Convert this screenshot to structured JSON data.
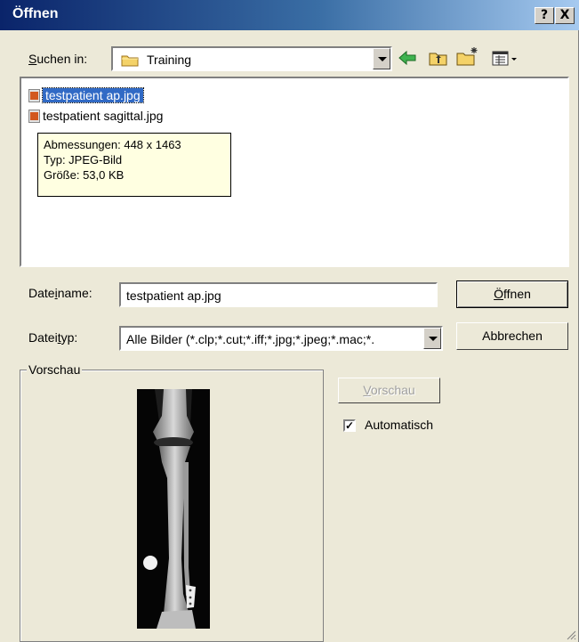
{
  "window": {
    "title": "Öffnen",
    "help_button": "?",
    "close_button": "X"
  },
  "look_in": {
    "label_u": "S",
    "label_rest": "uchen in:",
    "value": "Training"
  },
  "files": [
    {
      "name": "testpatient ap.jpg",
      "selected": true
    },
    {
      "name": "testpatient sagittal.jpg",
      "selected": false
    }
  ],
  "tooltip": {
    "line1": "Abmessungen: 448 x 1463",
    "line2": "Typ: JPEG-Bild",
    "line3": "Größe: 53,0 KB"
  },
  "filename": {
    "label_a": "Date",
    "label_u": "i",
    "label_b": "name:",
    "value": "testpatient ap.jpg"
  },
  "filetype": {
    "label_a": "Datei",
    "label_u": "t",
    "label_b": "yp:",
    "value": "Alle Bilder (*.clp;*.cut;*.iff;*.jpg;*.jpeg;*.mac;*."
  },
  "buttons": {
    "open_u": "Ö",
    "open_rest": "ffnen",
    "cancel": "Abbrechen",
    "preview_u": "V",
    "preview_rest": "orschau"
  },
  "preview": {
    "group_label": "Vorschau",
    "auto_label": "Automatisch",
    "auto_checked": true
  },
  "colors": {
    "titlebar_start": "#0a246a",
    "selection": "#316ac5",
    "tooltip_bg": "#ffffe1"
  }
}
